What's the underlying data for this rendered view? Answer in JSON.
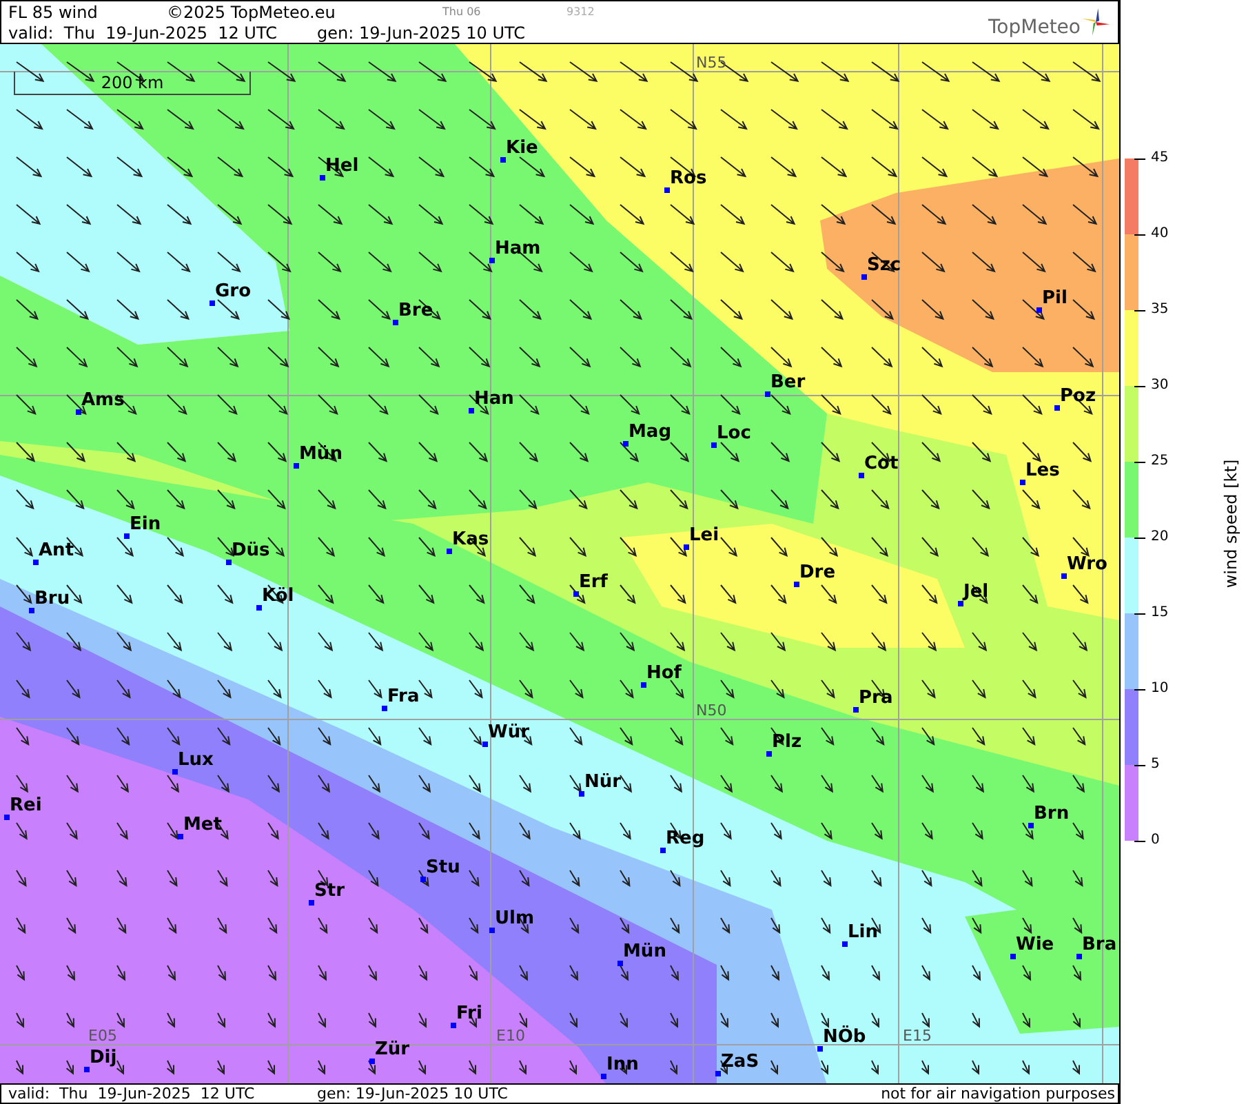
{
  "header": {
    "title": "FL 85 wind",
    "copyright": "©2025 TopMeteo.eu",
    "slot": "Thu 06",
    "code": "9312",
    "valid": "valid:  Thu  19-Jun-2025  12 UTC",
    "generated": "gen: 19-Jun-2025 10 UTC",
    "logo": "TopMeteo"
  },
  "map": {
    "scale_bar": "200 km",
    "grid_labels": [
      "N55",
      "N50",
      "E05",
      "E10",
      "E15"
    ],
    "cities": [
      "Kie",
      "Hel",
      "Ros",
      "Ham",
      "Szc",
      "Gro",
      "Bre",
      "Pil",
      "Ber",
      "Ams",
      "Han",
      "Poz",
      "Mag",
      "Loc",
      "Mün",
      "Cot",
      "Les",
      "Ein",
      "Ant",
      "Düs",
      "Kas",
      "Lei",
      "Bru",
      "Köl",
      "Erf",
      "Dre",
      "Jel",
      "Wro",
      "Hof",
      "Fra",
      "Pra",
      "Wür",
      "Plz",
      "Lux",
      "Nür",
      "Rei",
      "Met",
      "Brn",
      "Reg",
      "Stu",
      "Str",
      "Lin",
      "Ulm",
      "Wie",
      "Bra",
      "Mün",
      "Fri",
      "NÖb",
      "Dij",
      "Zür",
      "Inn",
      "ZaS"
    ]
  },
  "footer": {
    "valid": "valid:  Thu  19-Jun-2025  12 UTC",
    "generated": "gen: 19-Jun-2025 10 UTC",
    "disclaimer": "not for air navigation purposes"
  },
  "legend": {
    "title": "wind speed [kt]",
    "ticks": [
      "45",
      "40",
      "35",
      "30",
      "25",
      "20",
      "15",
      "10",
      "5",
      "0"
    ],
    "bands": [
      {
        "color": "#f47c64"
      },
      {
        "color": "#fcb064"
      },
      {
        "color": "#fcfc64"
      },
      {
        "color": "#c4fc64"
      },
      {
        "color": "#78f870"
      },
      {
        "color": "#b0fcfc"
      },
      {
        "color": "#98c4fc"
      },
      {
        "color": "#9080fc"
      },
      {
        "color": "#c880fc"
      }
    ]
  }
}
